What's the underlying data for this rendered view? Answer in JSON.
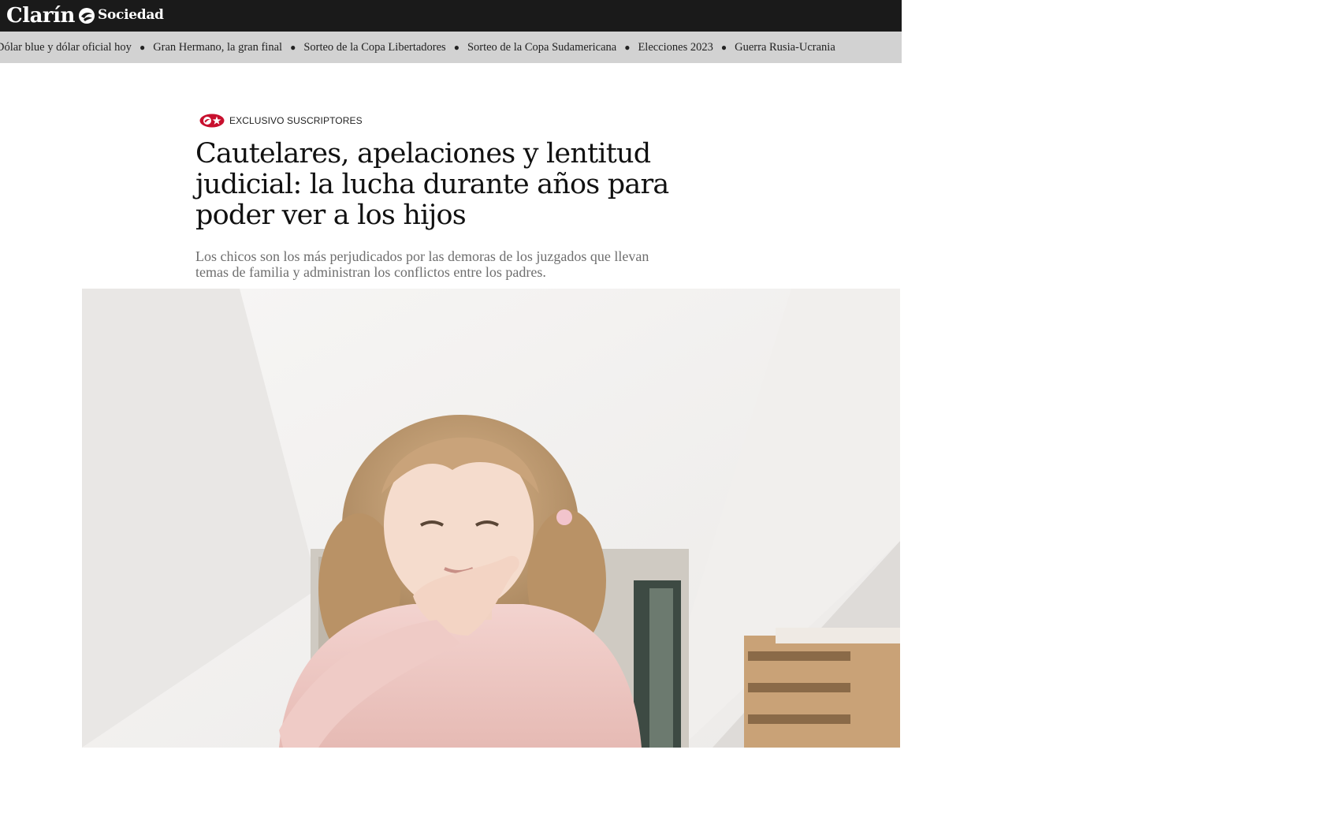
{
  "header": {
    "brand": "Clarín",
    "section": "Sociedad"
  },
  "trending": {
    "items": [
      "Dólar blue y dólar oficial hoy",
      "Gran Hermano, la gran final",
      "Sorteo de la Copa Libertadores",
      "Sorteo de la Copa Sudamericana",
      "Elecciones 2023",
      "Guerra Rusia-Ucrania"
    ]
  },
  "article": {
    "badge": "EXCLUSIVO SUSCRIPTORES",
    "headline": "Cautelares, apelaciones y lentitud judicial: la lucha durante años para poder ver a los hijos",
    "summary": "Los chicos son los más perjudicados por las demoras de los juzgados que llevan temas de familia y administran los conflictos entre los padres."
  },
  "colors": {
    "topbar": "#1a1a1a",
    "trending_bg": "#d2d2d2",
    "badge_red": "#c8102e"
  },
  "icons": {
    "brand": "clarin-logo-icon",
    "badge": "subscriber-star-icon"
  }
}
